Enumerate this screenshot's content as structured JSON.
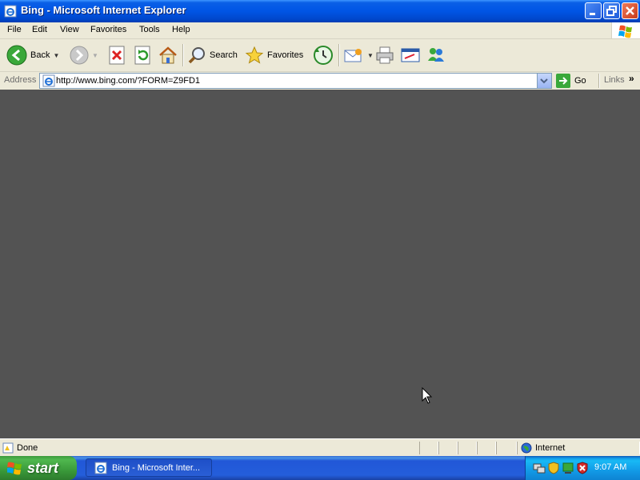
{
  "window": {
    "title": "Bing - Microsoft Internet Explorer"
  },
  "menubar": {
    "items": [
      "File",
      "Edit",
      "View",
      "Favorites",
      "Tools",
      "Help"
    ]
  },
  "toolbar": {
    "back_label": "Back",
    "search_label": "Search",
    "favorites_label": "Favorites"
  },
  "addressbar": {
    "label": "Address",
    "url": "http://www.bing.com/?FORM=Z9FD1",
    "go_label": "Go",
    "links_label": "Links",
    "links_chevron": "»"
  },
  "content": {
    "background": "#535353"
  },
  "statusbar": {
    "status": "Done",
    "zone": "Internet"
  },
  "taskbar": {
    "start_label": "start",
    "task_label": "Bing - Microsoft Inter...",
    "clock": "9:07 AM"
  },
  "colors": {
    "titlebar": "#0055e5",
    "chrome": "#ece9d8",
    "taskbar": "#245edb",
    "start": "#3a9a3a"
  }
}
